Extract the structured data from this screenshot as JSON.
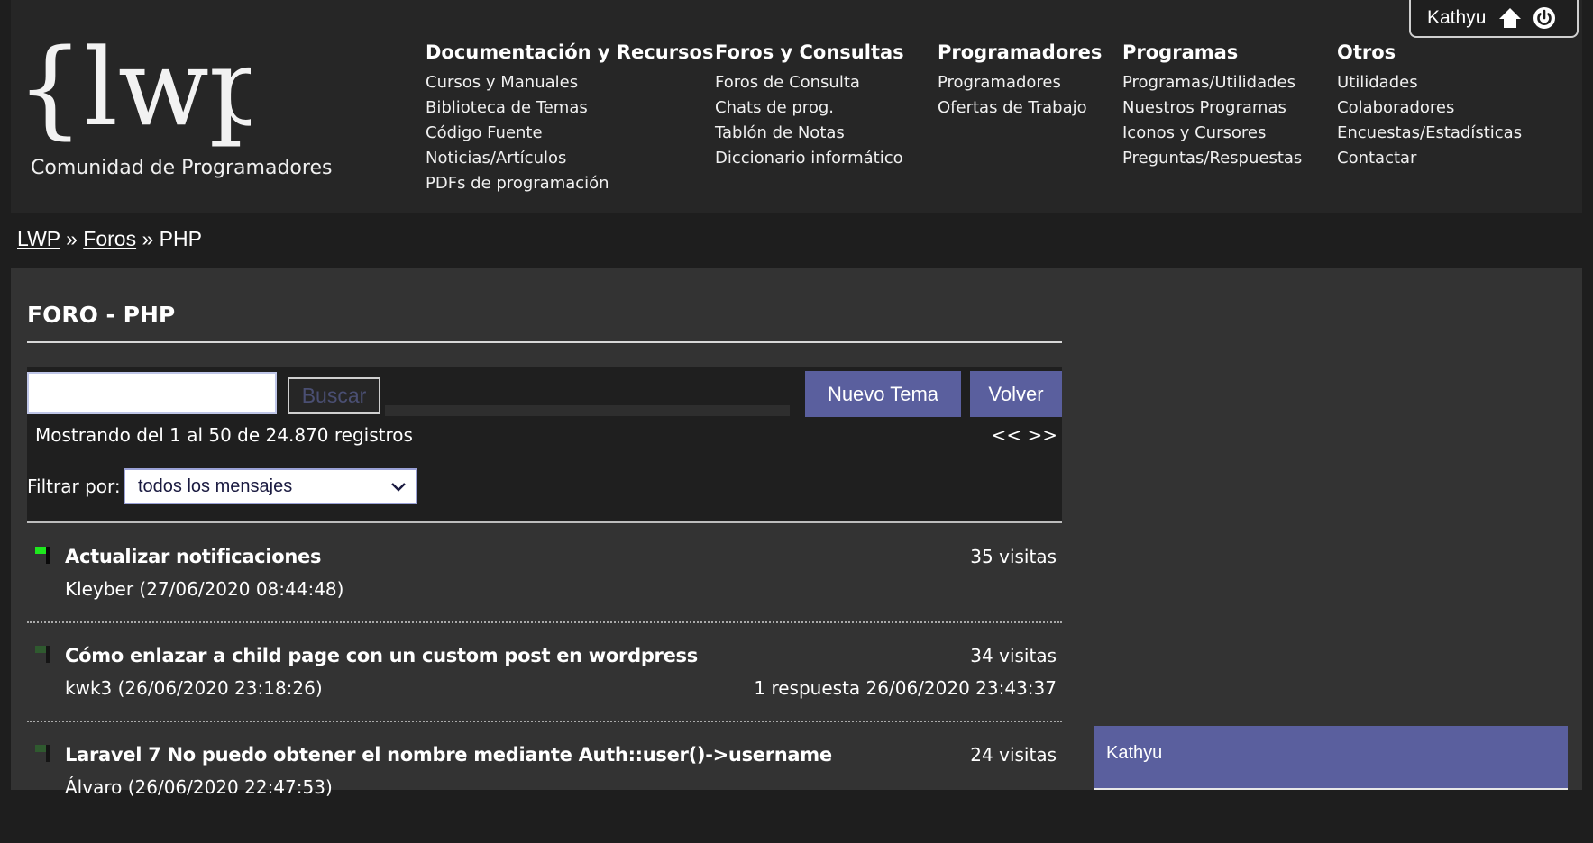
{
  "user": {
    "name": "Kathyu",
    "icons": [
      "home-icon",
      "power-icon"
    ]
  },
  "logo": {
    "text": "{lwp}",
    "tagline": "Comunidad de Programadores"
  },
  "nav": [
    {
      "title": "Documentación y Recursos",
      "links": [
        "Cursos y Manuales",
        "Biblioteca de Temas",
        "Código Fuente",
        "Noticias/Artículos",
        "PDFs de programación"
      ]
    },
    {
      "title": "Foros y Consultas",
      "links": [
        "Foros de Consulta",
        "Chats de prog.",
        "Tablón de Notas",
        "Diccionario informático"
      ]
    },
    {
      "title": "Programadores",
      "links": [
        "Programadores",
        "Ofertas de Trabajo"
      ]
    },
    {
      "title": "Programas",
      "links": [
        "Programas/Utilidades",
        "Nuestros Programas",
        "Iconos y Cursores",
        "Preguntas/Respuestas"
      ]
    },
    {
      "title": "Otros",
      "links": [
        "Utilidades",
        "Colaboradores",
        "Encuestas/Estadísticas",
        "Contactar"
      ]
    }
  ],
  "breadcrumb": {
    "items": [
      "LWP",
      "Foros"
    ],
    "current": "PHP",
    "separator": "»"
  },
  "forum": {
    "title": "FORO - PHP",
    "search": {
      "value": "",
      "button": "Buscar"
    },
    "new_topic": "Nuevo Tema",
    "back": "Volver",
    "showing": "Mostrando del 1 al 50 de 24.870 registros",
    "pager": {
      "prev": "<<",
      "next": ">>"
    },
    "filter": {
      "label": "Filtrar por:",
      "selected": "todos los mensajes"
    },
    "topics": [
      {
        "title": "Actualizar notificaciones",
        "author": "Kleyber (27/06/2020 08:44:48)",
        "visits": "35 visitas",
        "reply": "",
        "status": "new"
      },
      {
        "title": "Cómo enlazar a child page con un custom post en wordpress",
        "author": "kwk3 (26/06/2020 23:18:26)",
        "visits": "34 visitas",
        "reply": "1 respuesta 26/06/2020 23:43:37",
        "status": "read"
      },
      {
        "title": "Laravel 7 No puedo obtener el nombre mediante Auth::user()->username",
        "author": "Álvaro (26/06/2020 22:47:53)",
        "visits": "24 visitas",
        "reply": "",
        "status": "read"
      }
    ]
  },
  "sidebar": {
    "user": "Kathyu"
  },
  "colors": {
    "accent": "#5a5f9e",
    "flag_new": "#1ee81e",
    "flag_read": "#2f5a2f",
    "background": "#1e1e1e",
    "panel": "#333333"
  }
}
